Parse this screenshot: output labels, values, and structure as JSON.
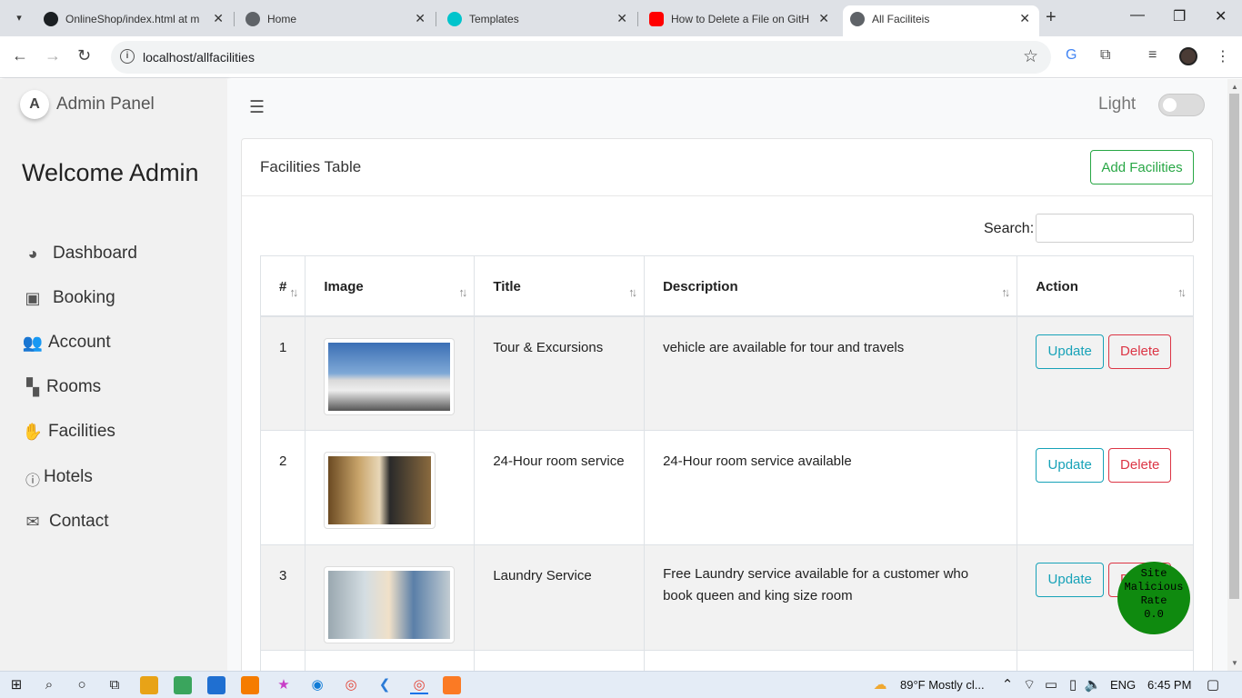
{
  "browser": {
    "tabs": [
      {
        "title": "OnlineShop/index.html at m",
        "favicon_color": "#1b1f23"
      },
      {
        "title": "Home",
        "favicon_color": "#5f6368"
      },
      {
        "title": "Templates",
        "favicon_color": "#00c4cc"
      },
      {
        "title": "How to Delete a File on GitH",
        "favicon_color": "#ff0000"
      },
      {
        "title": "All Faciliteis",
        "favicon_color": "#5f6368"
      }
    ],
    "url": "localhost/allfacilities"
  },
  "sidebar": {
    "brand": "Admin Panel",
    "brand_logo": "A",
    "welcome": "Welcome Admin",
    "items": [
      {
        "label": "Dashboard",
        "icon": "palette-icon"
      },
      {
        "label": "Booking",
        "icon": "calendar-check-icon"
      },
      {
        "label": "Account",
        "icon": "users-icon"
      },
      {
        "label": "Rooms",
        "icon": "door-open-icon"
      },
      {
        "label": "Facilities",
        "icon": "handshake-icon"
      },
      {
        "label": "Hotels",
        "icon": "info-circle-icon"
      },
      {
        "label": "Contact",
        "icon": "envelope-open-icon"
      }
    ]
  },
  "topbar": {
    "theme_label": "Light",
    "toggle_on": false
  },
  "card": {
    "title": "Facilities Table",
    "add_button": "Add Facilities",
    "search_label": "Search:",
    "search_value": ""
  },
  "table": {
    "headers": [
      "#",
      "Image",
      "Title",
      "Description",
      "Action"
    ],
    "rows": [
      {
        "num": "1",
        "image": "buses-image",
        "title": "Tour & Excursions",
        "description": "vehicle are available for tour and travels"
      },
      {
        "num": "2",
        "image": "room-service-waiter-image",
        "title": "24-Hour room service",
        "description": "24-Hour room service available"
      },
      {
        "num": "3",
        "image": "laundry-woman-image",
        "title": "Laundry Service",
        "description": "Free Laundry service available for a customer who book queen and king size room"
      }
    ],
    "update_label": "Update",
    "delete_label": "Delete"
  },
  "badge": {
    "line1": "Site",
    "line2": "Malicious",
    "line3": "Rate",
    "line4": "0.0",
    "color": "#0f8a0f"
  },
  "taskbar": {
    "weather": "89°F  Mostly cl...",
    "language": "ENG",
    "time": "6:45 PM"
  }
}
